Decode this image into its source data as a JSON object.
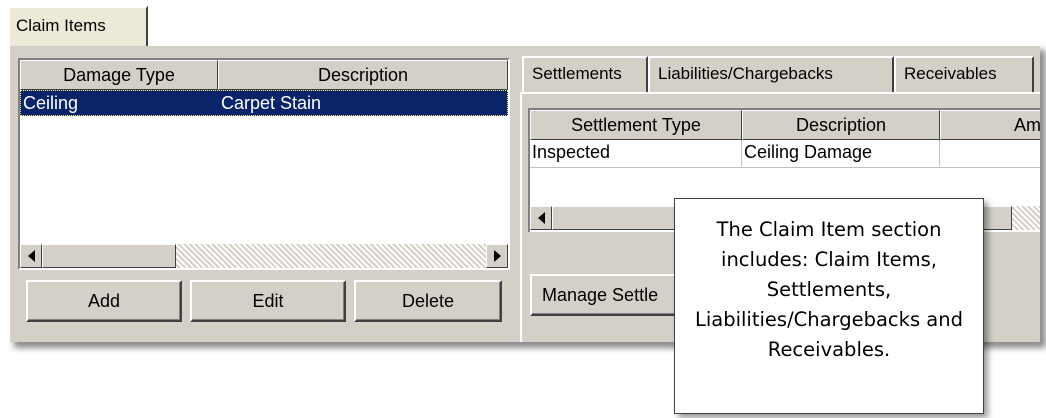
{
  "tabs": {
    "claim_items": "Claim Items"
  },
  "left_grid": {
    "columns": [
      "Damage Type",
      "Description"
    ],
    "rows": [
      {
        "damage_type": "Ceiling",
        "description": "Carpet Stain",
        "selected": true
      }
    ]
  },
  "left_buttons": {
    "add": "Add",
    "edit": "Edit",
    "delete": "Delete"
  },
  "right_tabs": [
    {
      "label": "Settlements",
      "active": true
    },
    {
      "label": "Liabilities/Chargebacks",
      "active": false
    },
    {
      "label": "Receivables",
      "active": false
    }
  ],
  "right_grid": {
    "columns": [
      "Settlement Type",
      "Description",
      "Amou"
    ],
    "rows": [
      {
        "settlement_type": "Inspected",
        "description": "Ceiling Damage",
        "amount": ""
      }
    ]
  },
  "right_buttons": {
    "manage": "Manage Settle"
  },
  "callout": {
    "text": "The Claim Item section includes: Claim Items, Settlements, Liabilities/Chargebacks and Receivables."
  },
  "colors": {
    "selection": "#0a246a",
    "face": "#d4d0c8"
  }
}
